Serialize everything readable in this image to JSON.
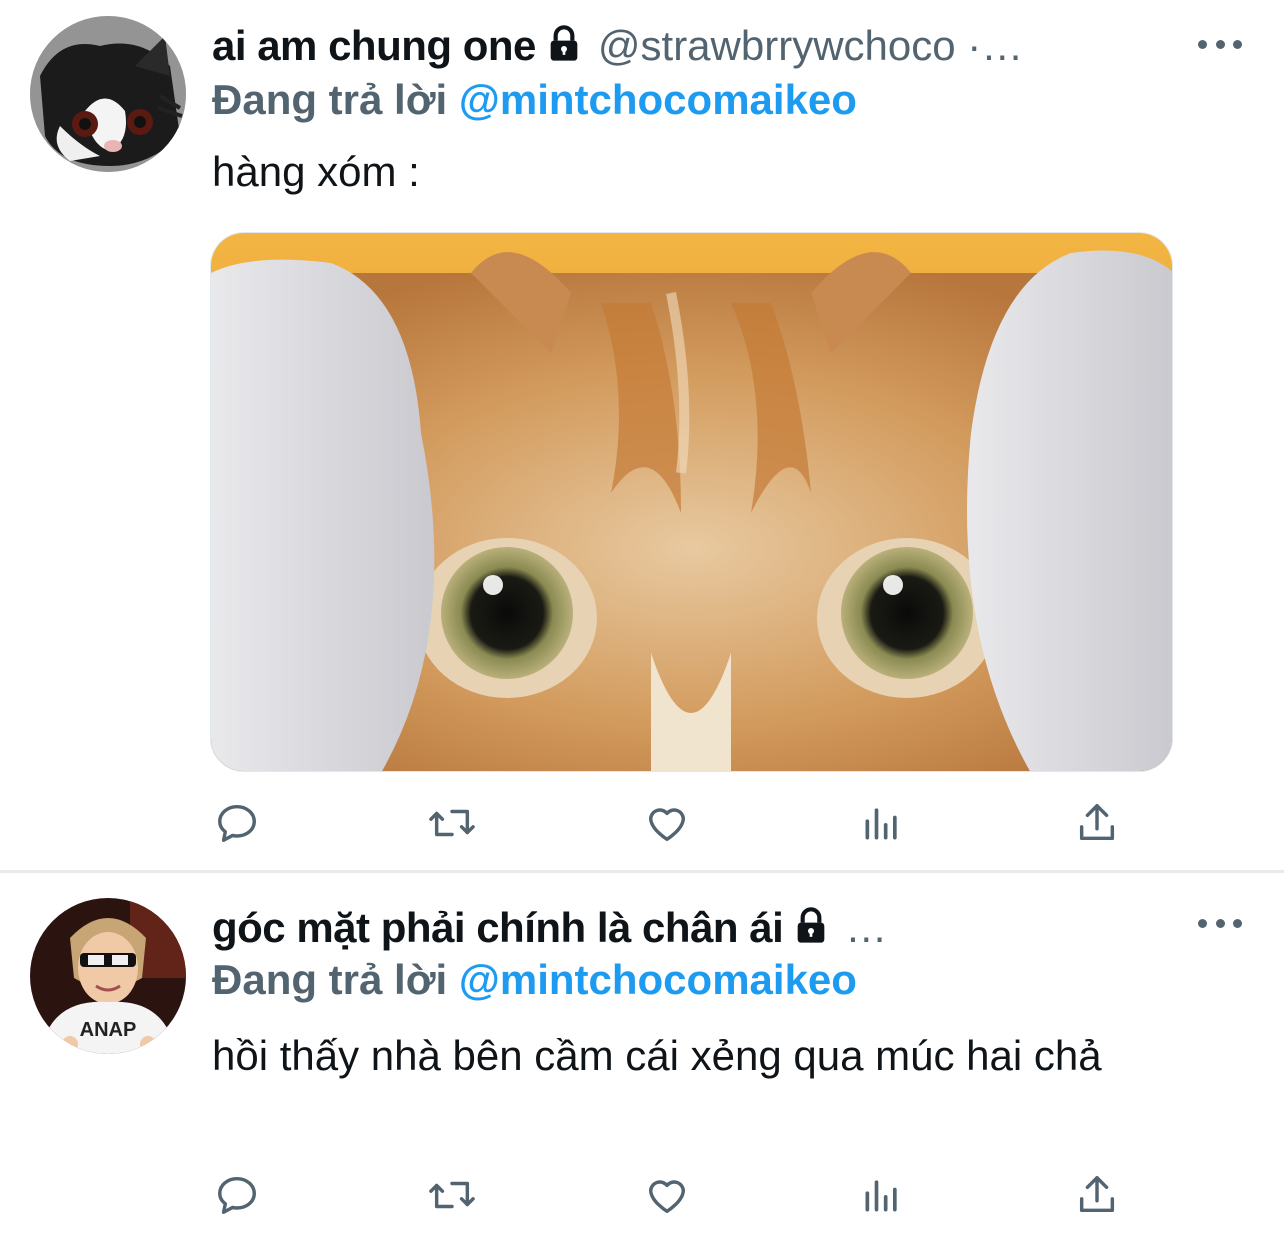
{
  "tweets": [
    {
      "display_name": "ai am chung one",
      "protected_icon": "lock-icon",
      "handle": "@strawbrrywchoco ·…",
      "reply_label": "Đang trả lời",
      "reply_mention": "@mintchocomaikeo",
      "text": "hàng xóm :",
      "has_media": true,
      "actions": [
        "reply-icon",
        "retweet-icon",
        "like-icon",
        "analytics-icon",
        "share-icon"
      ]
    },
    {
      "display_name": "góc mặt phải chính là chân ái",
      "protected_icon": "lock-icon",
      "handle": "…",
      "reply_label": "Đang trả lời",
      "reply_mention": "@mintchocomaikeo",
      "text": "hồi thấy nhà bên cầm cái xẻng qua múc hai chả",
      "has_media": false,
      "actions": [
        "reply-icon",
        "retweet-icon",
        "like-icon",
        "analytics-icon",
        "share-icon"
      ]
    }
  ],
  "avatar2_shirt_text": "ANAP",
  "colors": {
    "primary_text": "#0f1419",
    "secondary_text": "#536471",
    "link": "#1d9bf0",
    "divider": "#e7e9ea"
  }
}
